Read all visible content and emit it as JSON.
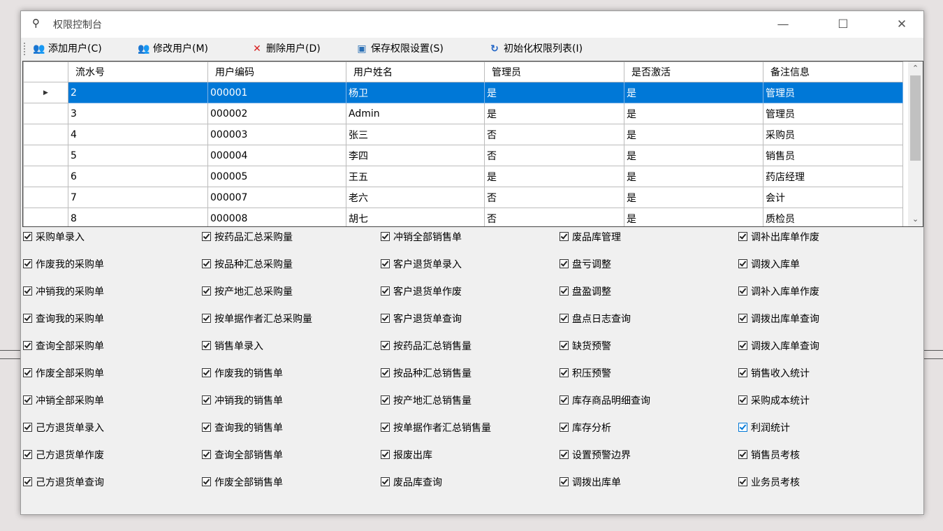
{
  "window": {
    "title": "权限控制台"
  },
  "toolbar": {
    "add_user": "添加用户(C)",
    "modify_user": "修改用户(M)",
    "delete_user": "删除用户(D)",
    "save_perms": "保存权限设置(S)",
    "init_perms": "初始化权限列表(I)"
  },
  "grid": {
    "columns": [
      "流水号",
      "用户编码",
      "用户姓名",
      "管理员",
      "是否激活",
      "备注信息"
    ],
    "rows": [
      [
        "2",
        "000001",
        "杨卫",
        "是",
        "是",
        "管理员"
      ],
      [
        "3",
        "000002",
        "Admin",
        "是",
        "是",
        "管理员"
      ],
      [
        "4",
        "000003",
        "张三",
        "否",
        "是",
        "采购员"
      ],
      [
        "5",
        "000004",
        "李四",
        "否",
        "是",
        "销售员"
      ],
      [
        "6",
        "000005",
        "王五",
        "是",
        "是",
        "药店经理"
      ],
      [
        "7",
        "000007",
        "老六",
        "否",
        "是",
        "会计"
      ],
      [
        "8",
        "000008",
        "胡七",
        "否",
        "是",
        "质检员"
      ]
    ]
  },
  "permissions": [
    [
      "采购单录入",
      "作废我的采购单",
      "冲销我的采购单",
      "查询我的采购单",
      "查询全部采购单",
      "作废全部采购单",
      "冲销全部采购单",
      "己方退货单录入",
      "己方退货单作废",
      "己方退货单查询"
    ],
    [
      "按药品汇总采购量",
      "按品种汇总采购量",
      "按产地汇总采购量",
      "按单据作者汇总采购量",
      "销售单录入",
      "作废我的销售单",
      "冲销我的销售单",
      "查询我的销售单",
      "查询全部销售单",
      "作废全部销售单"
    ],
    [
      "冲销全部销售单",
      "客户退货单录入",
      "客户退货单作废",
      "客户退货单查询",
      "按药品汇总销售量",
      "按品种汇总销售量",
      "按产地汇总销售量",
      "按单据作者汇总销售量",
      "报废出库",
      "废品库查询"
    ],
    [
      "废品库管理",
      "盘亏调整",
      "盘盈调整",
      "盘点日志查询",
      "缺货预警",
      "积压预警",
      "库存商品明细查询",
      "库存分析",
      "设置预警边界",
      "调拨出库单"
    ],
    [
      "调补出库单作废",
      "调拨入库单",
      "调补入库单作废",
      "调拨出库单查询",
      "调拨入库单查询",
      "销售收入统计",
      "采购成本统计",
      "利润统计",
      "销售员考核",
      "业务员考核"
    ]
  ],
  "colors": {
    "selection": "#0078d7"
  }
}
